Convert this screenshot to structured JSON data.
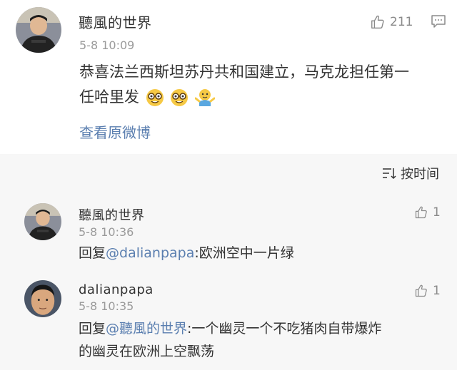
{
  "post": {
    "author": "聽風的世界",
    "time": "5-8 10:09",
    "like_count": "211",
    "text_line1": "恭喜法兰西斯坦苏丹共和国建立，马克龙担任第一",
    "text_line2": "任哈里发",
    "view_original": "查看原微博"
  },
  "sort": {
    "label": "按时间"
  },
  "comments": [
    {
      "author": "聽風的世界",
      "time": "5-8 10:36",
      "like_count": "1",
      "reply_prefix": "回复",
      "mention": "@dalianpapa",
      "text": ":欧洲空中一片绿"
    },
    {
      "author": "dalianpapa",
      "time": "5-8 10:35",
      "like_count": "1",
      "reply_prefix": "回复",
      "mention": "@聽風的世界",
      "text_line1": ":一个幽灵一个不吃猪肉自带爆炸",
      "text_line2": "的幽灵在欧洲上空飘荡"
    }
  ],
  "colors": {
    "link": "#5b7fb0",
    "muted": "#9a9a9a",
    "card_bg": "#ffffff",
    "page_bg": "#f7f7f7"
  }
}
